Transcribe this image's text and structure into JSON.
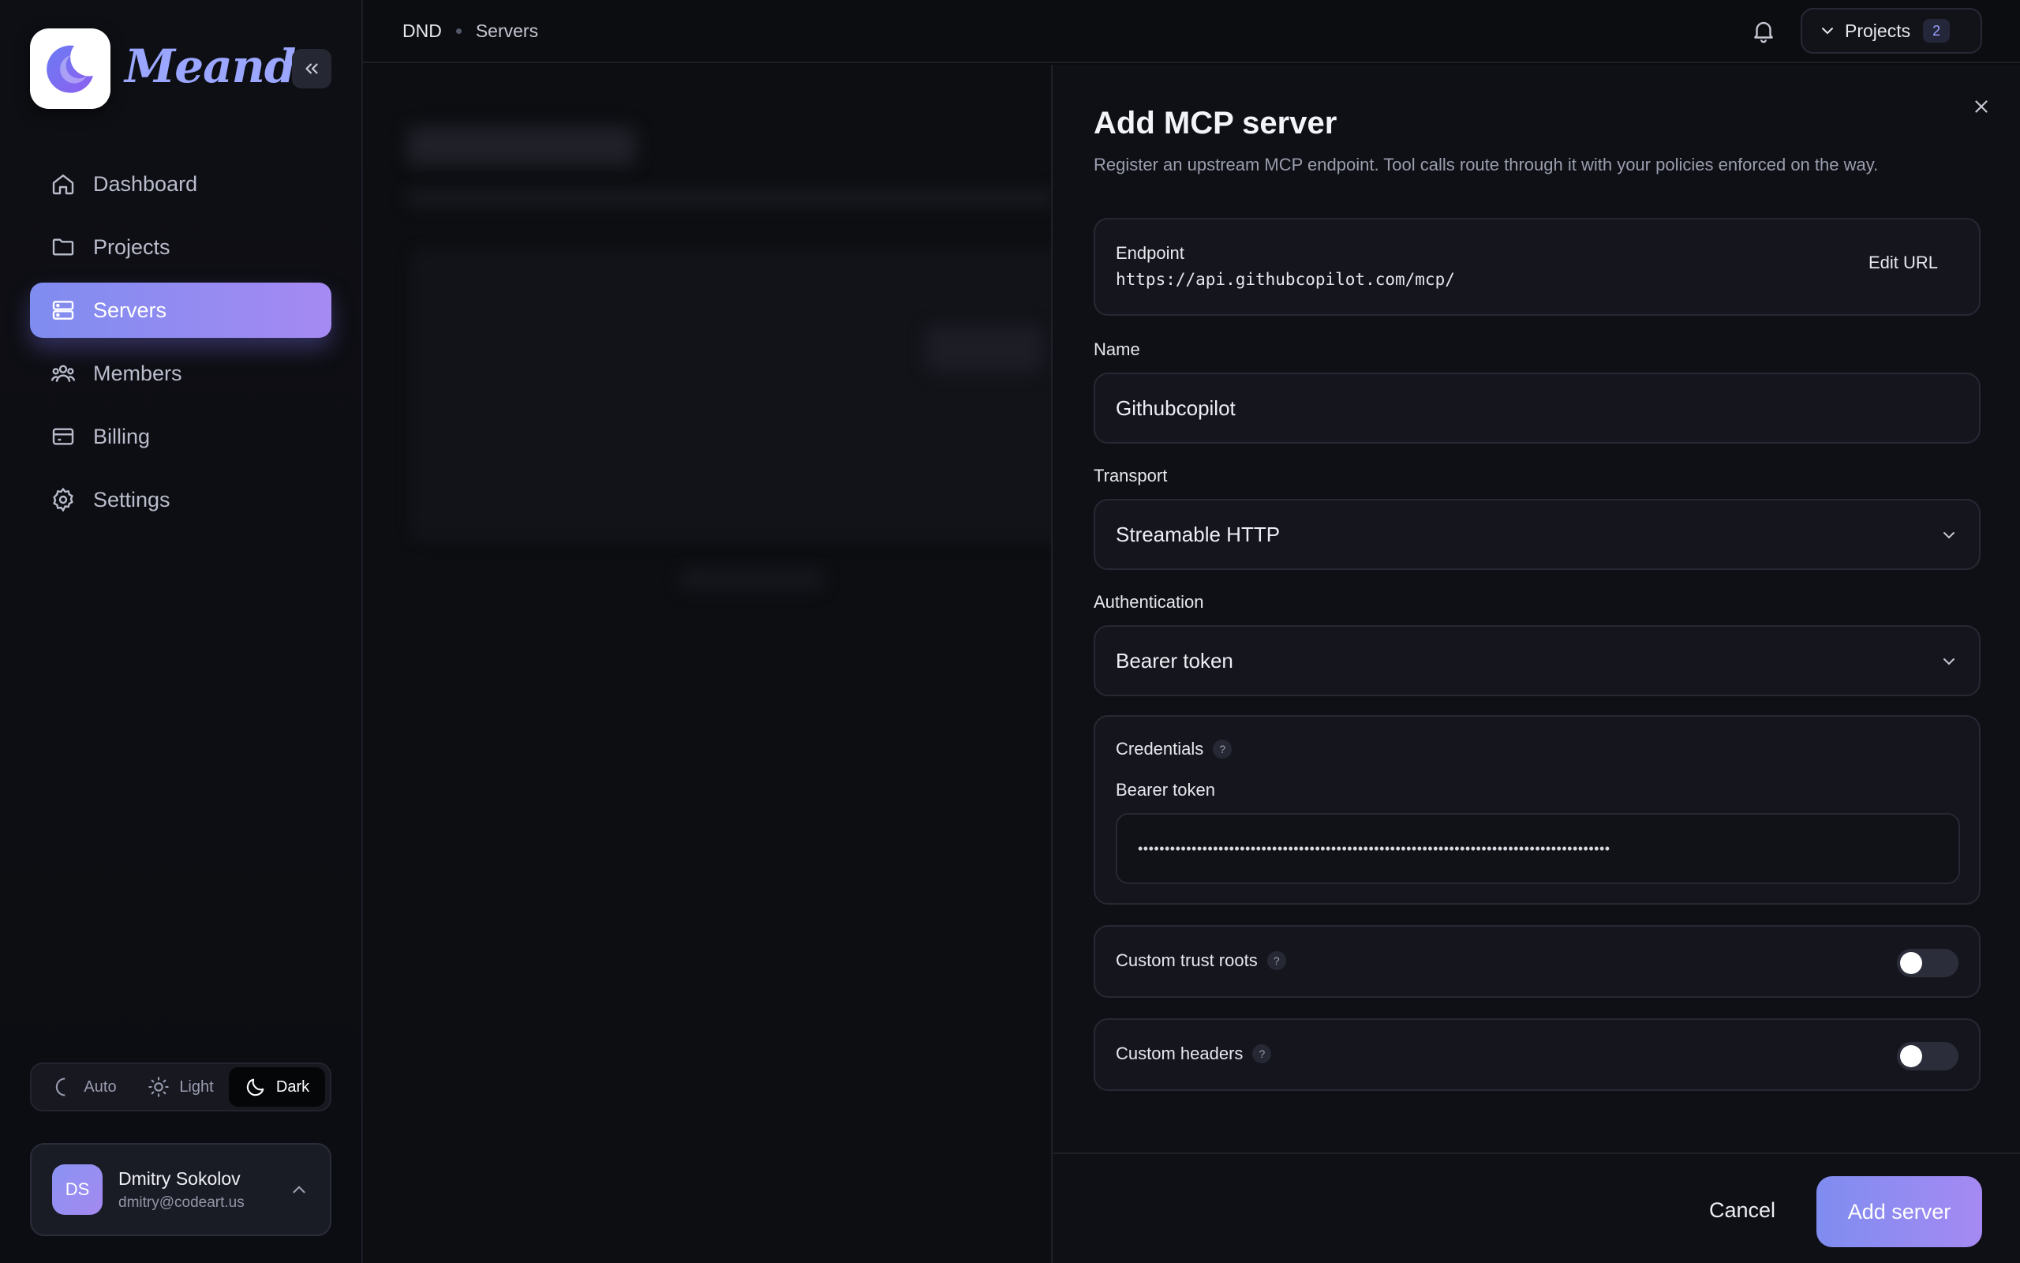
{
  "app": {
    "brand": "Meandr"
  },
  "sidebar": {
    "items": [
      {
        "label": "Dashboard",
        "icon": "home-icon"
      },
      {
        "label": "Projects",
        "icon": "folder-icon"
      },
      {
        "label": "Servers",
        "icon": "server-icon",
        "active": true
      },
      {
        "label": "Members",
        "icon": "users-icon"
      },
      {
        "label": "Billing",
        "icon": "card-icon"
      },
      {
        "label": "Settings",
        "icon": "gear-icon"
      }
    ],
    "theme": {
      "auto": "Auto",
      "light": "Light",
      "dark": "Dark",
      "selected": "Dark"
    },
    "user": {
      "initials": "DS",
      "name": "Dmitry Sokolov",
      "email": "dmitry@codeart.us"
    }
  },
  "topbar": {
    "breadcrumb": {
      "root": "DND",
      "page": "Servers"
    },
    "projects": {
      "label": "Projects",
      "count": "2"
    }
  },
  "panel": {
    "title": "Add MCP server",
    "description": "Register an upstream MCP endpoint. Tool calls route through it with your policies enforced on the way.",
    "endpoint": {
      "label": "Endpoint",
      "url": "https://api.githubcopilot.com/mcp/",
      "edit_label": "Edit URL"
    },
    "name": {
      "label": "Name",
      "value": "Githubcopilot"
    },
    "transport": {
      "label": "Transport",
      "value": "Streamable HTTP"
    },
    "authentication": {
      "label": "Authentication",
      "value": "Bearer token"
    },
    "credentials": {
      "title": "Credentials",
      "help": "?",
      "token_label": "Bearer token",
      "token_value": "••••••••••••••••••••••••••••••••••••••••••••••••••••••••••••••••••••••••••••••••••••••••"
    },
    "trust_roots": {
      "label": "Custom trust roots",
      "help": "?",
      "enabled": false
    },
    "headers": {
      "label": "Custom headers",
      "help": "?",
      "enabled": false
    },
    "footer": {
      "cancel": "Cancel",
      "submit": "Add server"
    }
  },
  "colors": {
    "accent_start": "#7f8cf0",
    "accent_end": "#a58af2",
    "background": "#0b0c10",
    "panel": "#0f1015"
  }
}
